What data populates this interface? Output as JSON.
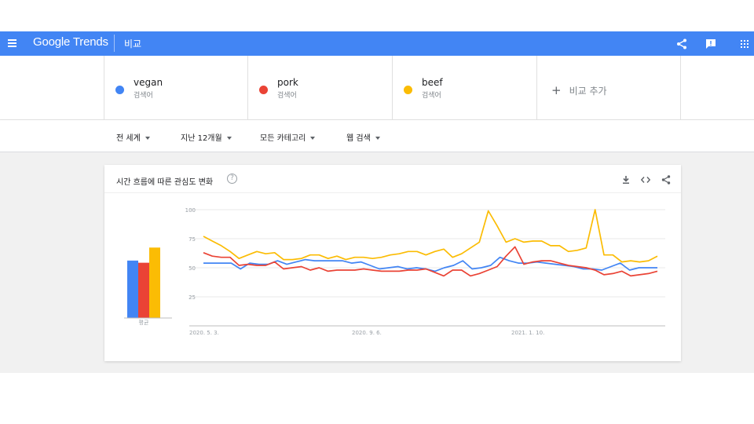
{
  "appbar": {
    "logo": "Google Trends",
    "title": "비교",
    "icons": [
      "menu-icon",
      "share-icon",
      "feedback-icon",
      "apps-icon"
    ]
  },
  "terms": [
    {
      "name": "vegan",
      "sub": "검색어",
      "color": "#4285f4"
    },
    {
      "name": "pork",
      "sub": "검색어",
      "color": "#ea4335"
    },
    {
      "name": "beef",
      "sub": "검색어",
      "color": "#fbbc04"
    }
  ],
  "add_term": {
    "icon": "+",
    "label": "비교 추가"
  },
  "filters": [
    {
      "label": "전 세계"
    },
    {
      "label": "지난 12개월"
    },
    {
      "label": "모든 카테고리"
    },
    {
      "label": "웹 검색"
    }
  ],
  "card": {
    "title": "시간 흐름에 따른 관심도 변화",
    "help": "?",
    "icons": [
      "download-icon",
      "embed-icon",
      "share-icon"
    ]
  },
  "chart_data": {
    "type": "line",
    "ylim": [
      0,
      100
    ],
    "yticks": [
      25,
      50,
      75,
      100
    ],
    "xtick_labels": [
      "2020. 5. 3.",
      "2020. 9. 6.",
      "2021. 1. 10."
    ],
    "average_label": "평균",
    "averages": [
      {
        "name": "vegan",
        "value": 53
      },
      {
        "name": "pork",
        "value": 51
      },
      {
        "name": "beef",
        "value": 65
      }
    ],
    "series": [
      {
        "name": "vegan",
        "color": "#4285f4",
        "values": [
          54,
          54,
          54,
          54,
          49,
          54,
          53,
          53,
          56,
          53,
          55,
          57,
          56,
          56,
          56,
          56,
          54,
          55,
          52,
          49,
          50,
          51,
          49,
          50,
          49,
          47,
          50,
          52,
          56,
          49,
          50,
          52,
          59,
          56,
          54,
          54,
          55,
          54,
          53,
          52,
          51,
          49,
          49,
          48,
          51,
          54,
          48,
          50,
          50,
          50
        ]
      },
      {
        "name": "pork",
        "color": "#ea4335",
        "values": [
          63,
          60,
          59,
          59,
          52,
          53,
          52,
          52,
          55,
          49,
          50,
          51,
          48,
          50,
          47,
          48,
          48,
          48,
          49,
          48,
          47,
          47,
          47,
          48,
          48,
          49,
          46,
          43,
          48,
          48,
          43,
          45,
          48,
          51,
          60,
          68,
          53,
          55,
          56,
          56,
          54,
          52,
          51,
          50,
          48,
          44,
          45,
          47,
          43,
          44,
          45,
          47
        ]
      },
      {
        "name": "beef",
        "color": "#fbbc04",
        "values": [
          77,
          73,
          69,
          64,
          58,
          61,
          64,
          62,
          63,
          57,
          57,
          58,
          61,
          61,
          58,
          60,
          57,
          59,
          59,
          58,
          59,
          61,
          62,
          64,
          64,
          61,
          64,
          66,
          59,
          62,
          67,
          72,
          99,
          86,
          72,
          75,
          72,
          73,
          73,
          69,
          69,
          64,
          65,
          67,
          100,
          61,
          61,
          55,
          56,
          55,
          56,
          60
        ]
      }
    ]
  }
}
